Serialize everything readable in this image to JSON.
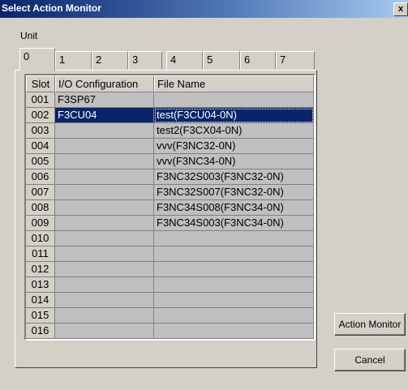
{
  "window": {
    "title": "Select Action Monitor",
    "close_glyph": "x"
  },
  "unit_label": "Unit",
  "tabs": [
    "0",
    "1",
    "2",
    "3",
    "4",
    "5",
    "6",
    "7"
  ],
  "active_tab": "0",
  "table": {
    "columns": [
      "Slot",
      "I/O Configuration",
      "File Name"
    ],
    "rows": [
      {
        "slot": "001",
        "io": "F3SP67",
        "file": ""
      },
      {
        "slot": "002",
        "io": "F3CU04",
        "file": "test(F3CU04-0N)"
      },
      {
        "slot": "003",
        "io": "",
        "file": "test2(F3CX04-0N)"
      },
      {
        "slot": "004",
        "io": "",
        "file": "vvv(F3NC32-0N)"
      },
      {
        "slot": "005",
        "io": "",
        "file": "vvv(F3NC34-0N)"
      },
      {
        "slot": "006",
        "io": "",
        "file": "F3NC32S003(F3NC32-0N)"
      },
      {
        "slot": "007",
        "io": "",
        "file": "F3NC32S007(F3NC32-0N)"
      },
      {
        "slot": "008",
        "io": "",
        "file": "F3NC34S008(F3NC34-0N)"
      },
      {
        "slot": "009",
        "io": "",
        "file": "F3NC34S003(F3NC34-0N)"
      },
      {
        "slot": "010",
        "io": "",
        "file": ""
      },
      {
        "slot": "011",
        "io": "",
        "file": ""
      },
      {
        "slot": "012",
        "io": "",
        "file": ""
      },
      {
        "slot": "013",
        "io": "",
        "file": ""
      },
      {
        "slot": "014",
        "io": "",
        "file": ""
      },
      {
        "slot": "015",
        "io": "",
        "file": ""
      },
      {
        "slot": "016",
        "io": "",
        "file": ""
      }
    ],
    "selected_slot": "002"
  },
  "buttons": {
    "action_monitor": "Action Monitor",
    "cancel": "Cancel"
  }
}
